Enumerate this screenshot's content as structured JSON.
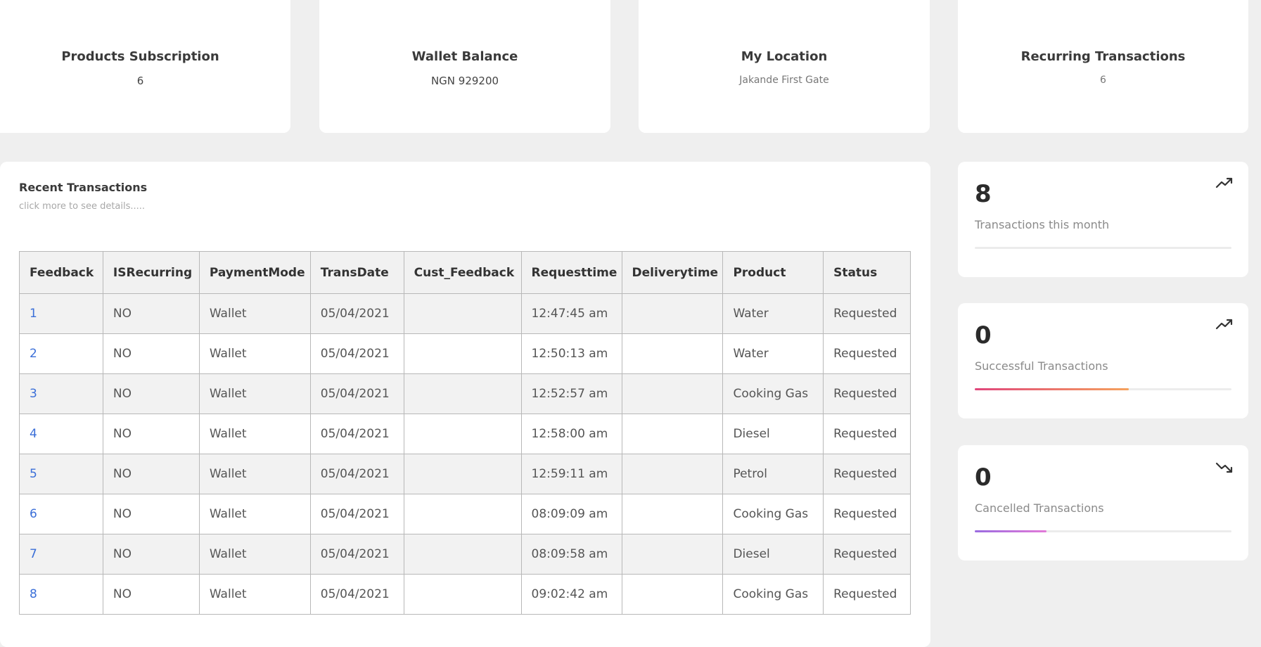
{
  "summary": [
    {
      "title": "Products Subscription",
      "value": "6"
    },
    {
      "title": "Wallet Balance",
      "value": "NGN 929200"
    },
    {
      "title": "My Location",
      "value": "Jakande First Gate"
    },
    {
      "title": "Recurring Transactions",
      "value": "6"
    }
  ],
  "recent": {
    "title": "Recent Transactions",
    "subtitle": "click more to see details.....",
    "columns": [
      "Feedback",
      "ISRecurring",
      "PaymentMode",
      "TransDate",
      "Cust_Feedback",
      "Requesttime",
      "Deliverytime",
      "Product",
      "Status"
    ],
    "rows": [
      {
        "feedback": "1",
        "is_recurring": "NO",
        "payment_mode": "Wallet",
        "trans_date": "05/04/2021",
        "cust_feedback": "",
        "request_time": "12:47:45 am",
        "delivery_time": "",
        "product": "Water",
        "status": "Requested"
      },
      {
        "feedback": "2",
        "is_recurring": "NO",
        "payment_mode": "Wallet",
        "trans_date": "05/04/2021",
        "cust_feedback": "",
        "request_time": "12:50:13 am",
        "delivery_time": "",
        "product": "Water",
        "status": "Requested"
      },
      {
        "feedback": "3",
        "is_recurring": "NO",
        "payment_mode": "Wallet",
        "trans_date": "05/04/2021",
        "cust_feedback": "",
        "request_time": "12:52:57 am",
        "delivery_time": "",
        "product": "Cooking Gas",
        "status": "Requested"
      },
      {
        "feedback": "4",
        "is_recurring": "NO",
        "payment_mode": "Wallet",
        "trans_date": "05/04/2021",
        "cust_feedback": "",
        "request_time": "12:58:00 am",
        "delivery_time": "",
        "product": "Diesel",
        "status": "Requested"
      },
      {
        "feedback": "5",
        "is_recurring": "NO",
        "payment_mode": "Wallet",
        "trans_date": "05/04/2021",
        "cust_feedback": "",
        "request_time": "12:59:11 am",
        "delivery_time": "",
        "product": "Petrol",
        "status": "Requested"
      },
      {
        "feedback": "6",
        "is_recurring": "NO",
        "payment_mode": "Wallet",
        "trans_date": "05/04/2021",
        "cust_feedback": "",
        "request_time": "08:09:09 am",
        "delivery_time": "",
        "product": "Cooking Gas",
        "status": "Requested"
      },
      {
        "feedback": "7",
        "is_recurring": "NO",
        "payment_mode": "Wallet",
        "trans_date": "05/04/2021",
        "cust_feedback": "",
        "request_time": "08:09:58 am",
        "delivery_time": "",
        "product": "Diesel",
        "status": "Requested"
      },
      {
        "feedback": "8",
        "is_recurring": "NO",
        "payment_mode": "Wallet",
        "trans_date": "05/04/2021",
        "cust_feedback": "",
        "request_time": "09:02:42 am",
        "delivery_time": "",
        "product": "Cooking Gas",
        "status": "Requested"
      }
    ]
  },
  "stats": [
    {
      "value": "8",
      "label": "Transactions this month",
      "icon": "trending-up-icon",
      "progress": 0,
      "gradient": [
        "#e0e0e0",
        "#e0e0e0"
      ]
    },
    {
      "value": "0",
      "label": "Successful Transactions",
      "icon": "trending-up-icon",
      "progress": 0.6,
      "gradient": [
        "#e0457b",
        "#f5a25d"
      ]
    },
    {
      "value": "0",
      "label": "Cancelled Transactions",
      "icon": "trending-down-icon",
      "progress": 0.28,
      "gradient": [
        "#9a6be0",
        "#e27ad8"
      ]
    }
  ],
  "colors": {
    "link": "#3b6fd8",
    "background": "#efefef",
    "card": "#ffffff"
  }
}
